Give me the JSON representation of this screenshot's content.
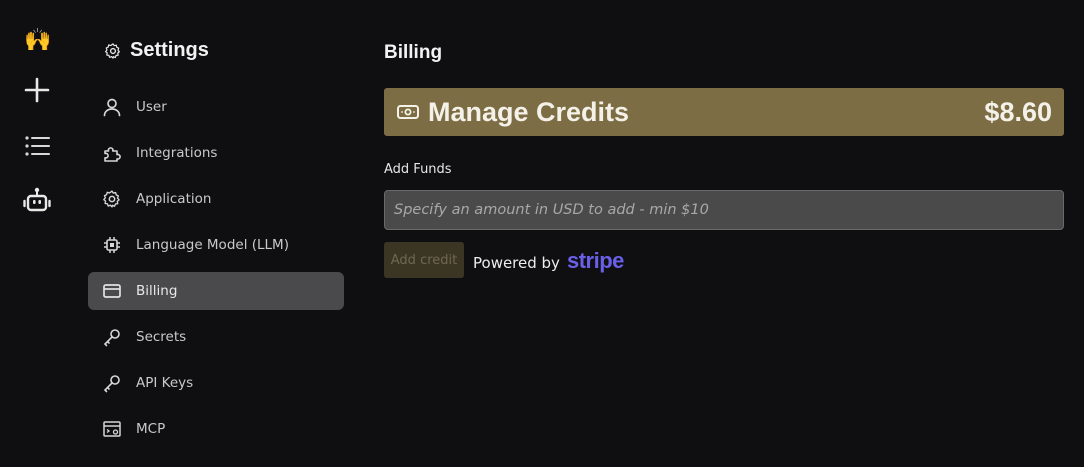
{
  "rail": {
    "logo_glyph": "🙌",
    "new_label": "+",
    "items": [
      "new-icon",
      "list-icon",
      "bot-icon"
    ]
  },
  "sidebar": {
    "title": "Settings",
    "items": [
      {
        "label": "User",
        "icon": "user-icon"
      },
      {
        "label": "Integrations",
        "icon": "puzzle-icon"
      },
      {
        "label": "Application",
        "icon": "gear-icon"
      },
      {
        "label": "Language Model (LLM)",
        "icon": "chip-icon"
      },
      {
        "label": "Billing",
        "icon": "credit-card-icon",
        "active": true
      },
      {
        "label": "Secrets",
        "icon": "key-icon"
      },
      {
        "label": "API Keys",
        "icon": "key-icon"
      },
      {
        "label": "MCP",
        "icon": "server-gear-icon"
      }
    ]
  },
  "main": {
    "title": "Billing",
    "credits": {
      "title": "Manage Credits",
      "amount": "$8.60",
      "icon": "banknote-icon"
    },
    "funds_label": "Add Funds",
    "input_placeholder": "Specify an amount in USD to add - min $10",
    "add_button": "Add credit",
    "powered_by": "Powered by",
    "stripe": "stripe"
  },
  "colors": {
    "background": "#0f0f11",
    "accent_gold": "#7c6d45",
    "active_nav": "#4a4a4c",
    "stripe_purple": "#6a5fe8"
  }
}
